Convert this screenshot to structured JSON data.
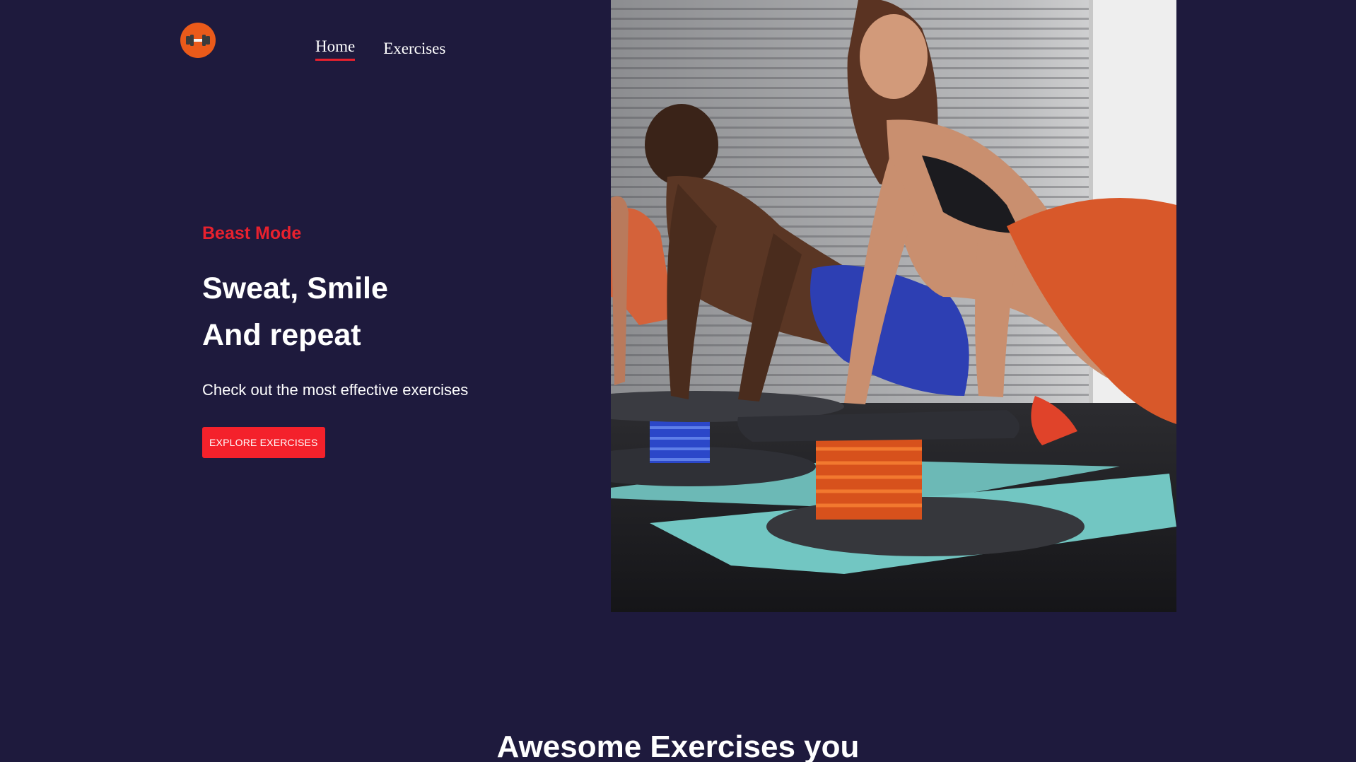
{
  "brand": {
    "logo_icon": "dumbbell-icon",
    "logo_color": "#ea5a1a"
  },
  "nav": {
    "items": [
      {
        "label": "Home",
        "active": true
      },
      {
        "label": "Exercises",
        "active": false
      }
    ],
    "accent": "#e8212e"
  },
  "hero": {
    "tagline": "Beast Mode",
    "headline_line1": "Sweat, Smile",
    "headline_line2": "And repeat",
    "subtitle": "Check out the most effective exercises",
    "cta_label": "EXPLORE EXERCISES",
    "cta_color": "#f4212b",
    "image_icon": "fitness-photo"
  },
  "section": {
    "title": "Awesome Exercises you"
  },
  "colors": {
    "background": "#1e1a3d",
    "text": "#ffffff",
    "accent": "#e8212e"
  }
}
